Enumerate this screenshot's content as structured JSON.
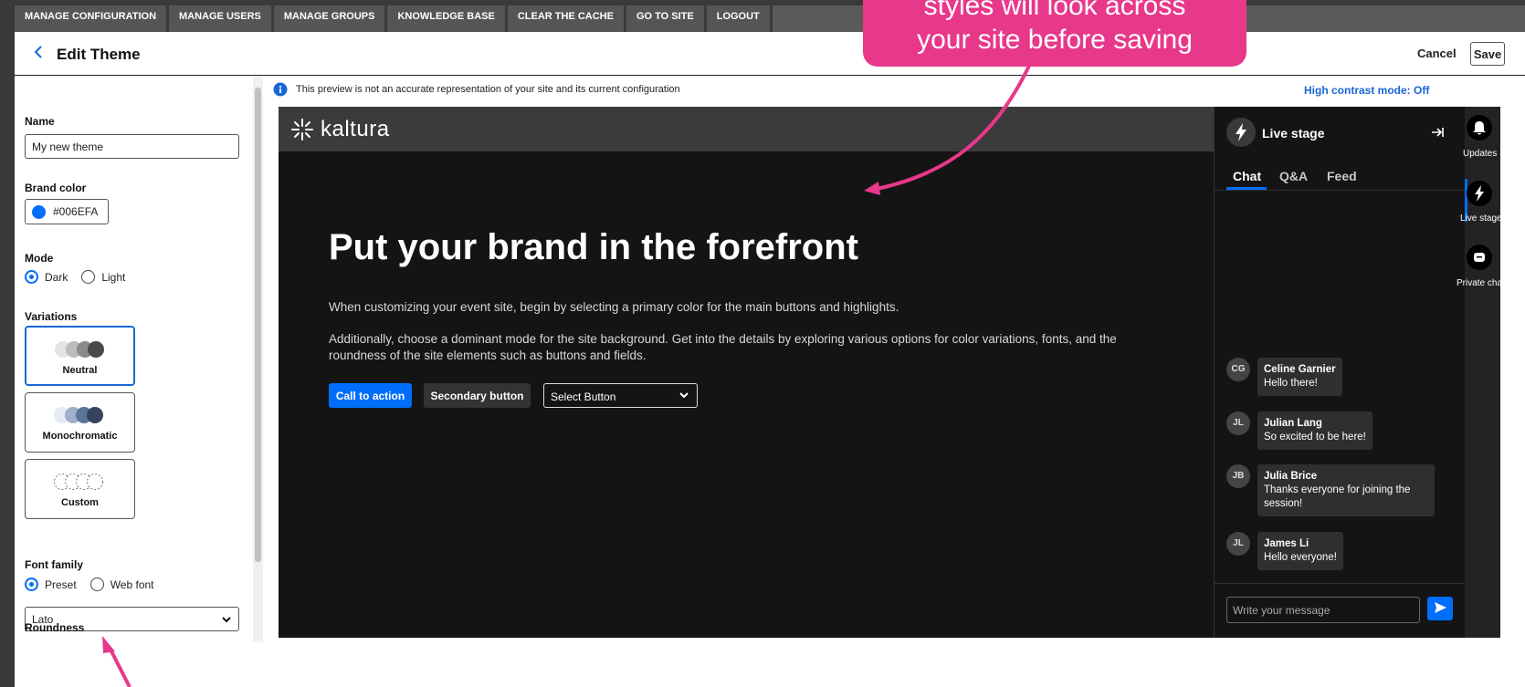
{
  "topnav": {
    "items": [
      "MANAGE CONFIGURATION",
      "MANAGE USERS",
      "MANAGE GROUPS",
      "KNOWLEDGE BASE",
      "CLEAR THE CACHE",
      "GO TO SITE",
      "LOGOUT"
    ]
  },
  "header": {
    "title": "Edit Theme",
    "cancel_label": "Cancel",
    "save_label": "Save"
  },
  "settings": {
    "name_label": "Name",
    "name_value": "My new theme",
    "brand_label": "Brand color",
    "brand_value": "#006EFA",
    "brand_color": "#006EFA",
    "mode_label": "Mode",
    "mode_options": [
      "Dark",
      "Light"
    ],
    "mode_selected": "Dark",
    "variations_label": "Variations",
    "variations": [
      {
        "name": "Neutral",
        "selected": true
      },
      {
        "name": "Monochromatic",
        "selected": false
      },
      {
        "name": "Custom",
        "selected": false
      }
    ],
    "font_label": "Font family",
    "font_options": [
      "Preset",
      "Web font"
    ],
    "font_selected": "Preset",
    "font_value": "Lato",
    "roundness_label": "Roundness"
  },
  "preview": {
    "info_text": "This preview is not an accurate representation of your site and its current configuration",
    "contrast_label": "High contrast mode: Off",
    "logo_text": "kaltura",
    "hero_title": "Put your brand in the forefront",
    "hero_p1": "When customizing your event site, begin by selecting a primary color for the main buttons and highlights.",
    "hero_p2": "Additionally, choose a dominant mode for the site background. Get into the details by exploring various options for color variations, fonts, and the roundness of the site elements such as buttons and fields.",
    "cta_label": "Call to action",
    "secondary_label": "Secondary button",
    "select_label": "Select Button"
  },
  "live_stage": {
    "title": "Live stage",
    "tabs": [
      "Chat",
      "Q&A",
      "Feed"
    ],
    "messages": [
      {
        "initials": "CG",
        "name": "Celine Garnier",
        "text": "Hello there!"
      },
      {
        "initials": "JL",
        "name": "Julian Lang",
        "text": "So excited to be here!"
      },
      {
        "initials": "JB",
        "name": "Julia Brice",
        "text": "Thanks everyone for joining the session!"
      },
      {
        "initials": "JL",
        "name": "James Li",
        "text": "Hello everyone!"
      }
    ],
    "input_placeholder": "Write your message"
  },
  "rail": {
    "items": [
      "Updates",
      "Live stage",
      "Private chat"
    ]
  },
  "callout": {
    "line1": "styles will look across",
    "line2": "your site before saving"
  },
  "colors": {
    "annotation": "#E8388A",
    "brand": "#006EFA"
  }
}
